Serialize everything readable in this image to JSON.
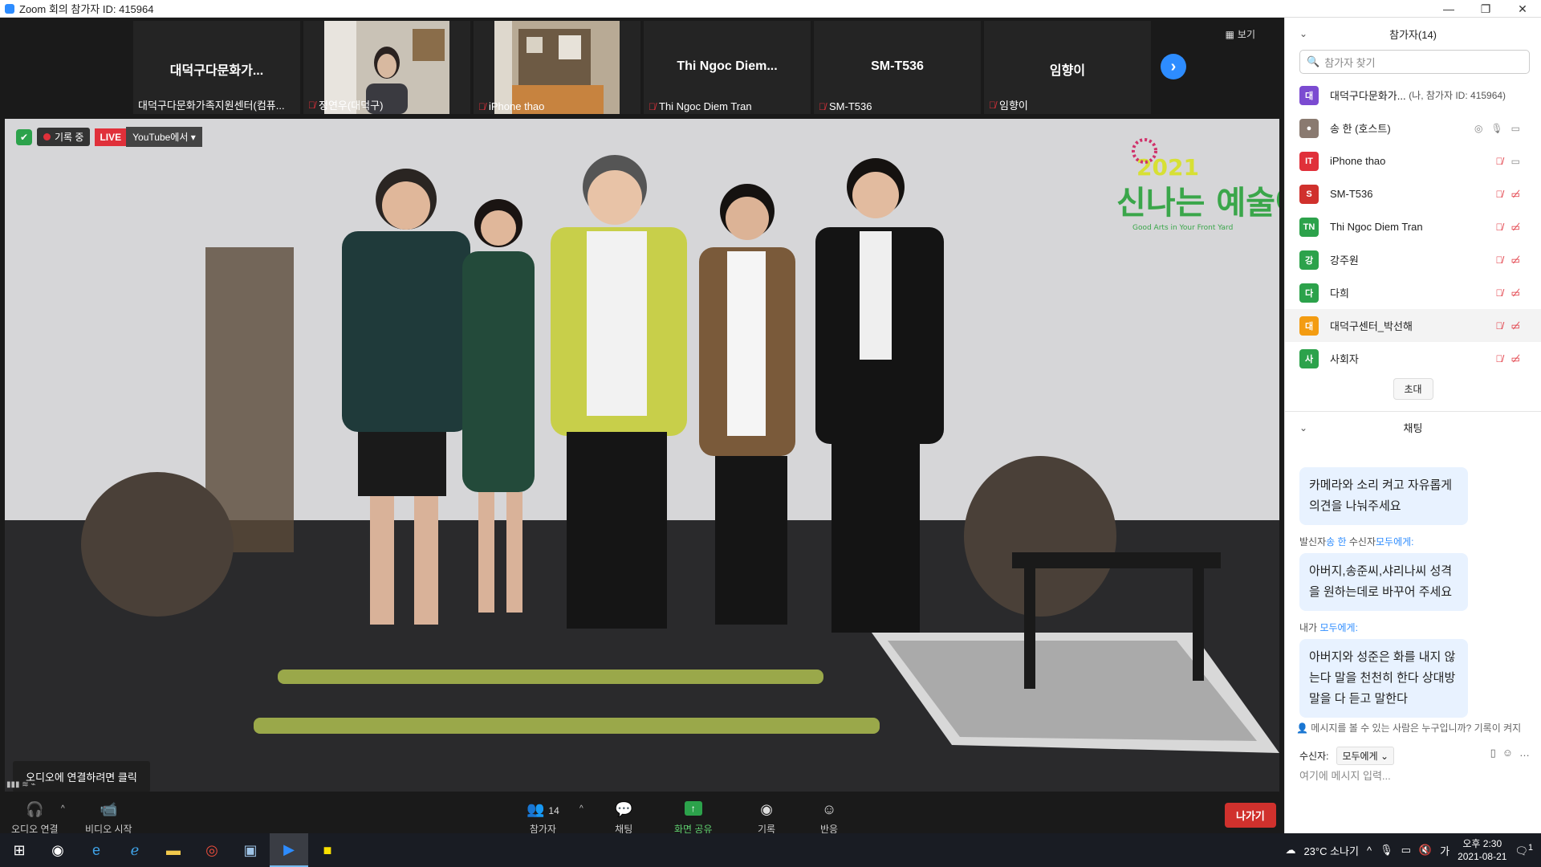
{
  "window": {
    "title": "Zoom 회의 참가자 ID: 415964",
    "minimize": "—",
    "restore": "❐",
    "close": "✕"
  },
  "strip": {
    "view_label": "보기",
    "tiles": [
      {
        "name": "대덕구다문화가...",
        "label": "대덕구다문화가족지원센터(컴퓨...",
        "photo": false
      },
      {
        "name": "",
        "label": "정연우(대덕구)",
        "photo": true
      },
      {
        "name": "",
        "label": "iPhone thao",
        "photo": true
      },
      {
        "name": "Thi Ngoc Diem...",
        "label": "Thi Ngoc Diem Tran",
        "photo": false
      },
      {
        "name": "SM-T536",
        "label": "SM-T536",
        "photo": false
      },
      {
        "name": "임향이",
        "label": "임향이",
        "photo": false
      }
    ]
  },
  "video": {
    "recording_label": "기록 중",
    "live_label": "LIVE",
    "youtube_label": "YouTube에서",
    "logo_year": "2021",
    "logo_text": "신나는 예술여행",
    "logo_sub": "Good Arts in Your Front Yard",
    "audio_tip": "오디오에 연결하려면 클릭"
  },
  "toolbar": {
    "audio": "오디오 연결",
    "video": "비디오 시작",
    "participants": "참가자",
    "participants_count": "14",
    "chat": "채팅",
    "share": "화면 공유",
    "record": "기록",
    "reactions": "반응",
    "leave": "나가기"
  },
  "participants": {
    "title": "참가자(14)",
    "search_placeholder": "참가자 찾기",
    "list": [
      {
        "initial": "대",
        "name": "대덕구다문화가...",
        "note": "(나, 참가자 ID: 415964)",
        "color": "#7b4bd1"
      },
      {
        "initial": "",
        "name": "송 한 (호스트)",
        "note": "",
        "color": "#666666"
      },
      {
        "initial": "IT",
        "name": "iPhone thao",
        "note": "",
        "color": "#e0303a"
      },
      {
        "initial": "S",
        "name": "SM-T536",
        "note": "",
        "color": "#d0312d"
      },
      {
        "initial": "TN",
        "name": "Thi Ngoc Diem Tran",
        "note": "",
        "color": "#2ca24b"
      },
      {
        "initial": "강",
        "name": "강주원",
        "note": "",
        "color": "#2ca24b"
      },
      {
        "initial": "다",
        "name": "다희",
        "note": "",
        "color": "#2ca24b"
      },
      {
        "initial": "대",
        "name": "대덕구센터_박선해",
        "note": "",
        "color": "#f39c12"
      },
      {
        "initial": "사",
        "name": "사회자",
        "note": "",
        "color": "#2ca24b"
      }
    ],
    "invite": "초대"
  },
  "chat": {
    "title": "채팅",
    "messages": [
      {
        "meta_prefix": "",
        "meta_from": "",
        "meta_mid": "",
        "meta_to": "",
        "text": "카메라와 소리 켜고 자유롭게 의견을 나눠주세요"
      },
      {
        "meta_prefix": "발신자",
        "meta_from": "송 한",
        "meta_mid": "수신자",
        "meta_to": "모두에게:",
        "text": "아버지,송준씨,샤리나씨 성격을 원하는데로 바꾸어 주세요"
      },
      {
        "meta_prefix": "내가",
        "meta_from": "",
        "meta_mid": "",
        "meta_to": "모두에게:",
        "text": "아버지와 성준은 화를 내지 않는다 말을 천천히 한다 상대방말을 다 듣고 말한다"
      }
    ],
    "hint": "메시지를 볼 수 있는 사람은 누구입니까? 기록이 켜지",
    "receiver_label": "수신자:",
    "receiver_value": "모두에게",
    "input_placeholder": "여기에 메시지 입력..."
  },
  "taskbar": {
    "weather": "23°C 소나기",
    "ime": "가",
    "time": "오후 2:30",
    "date": "2021-08-21",
    "notif_count": "1"
  }
}
